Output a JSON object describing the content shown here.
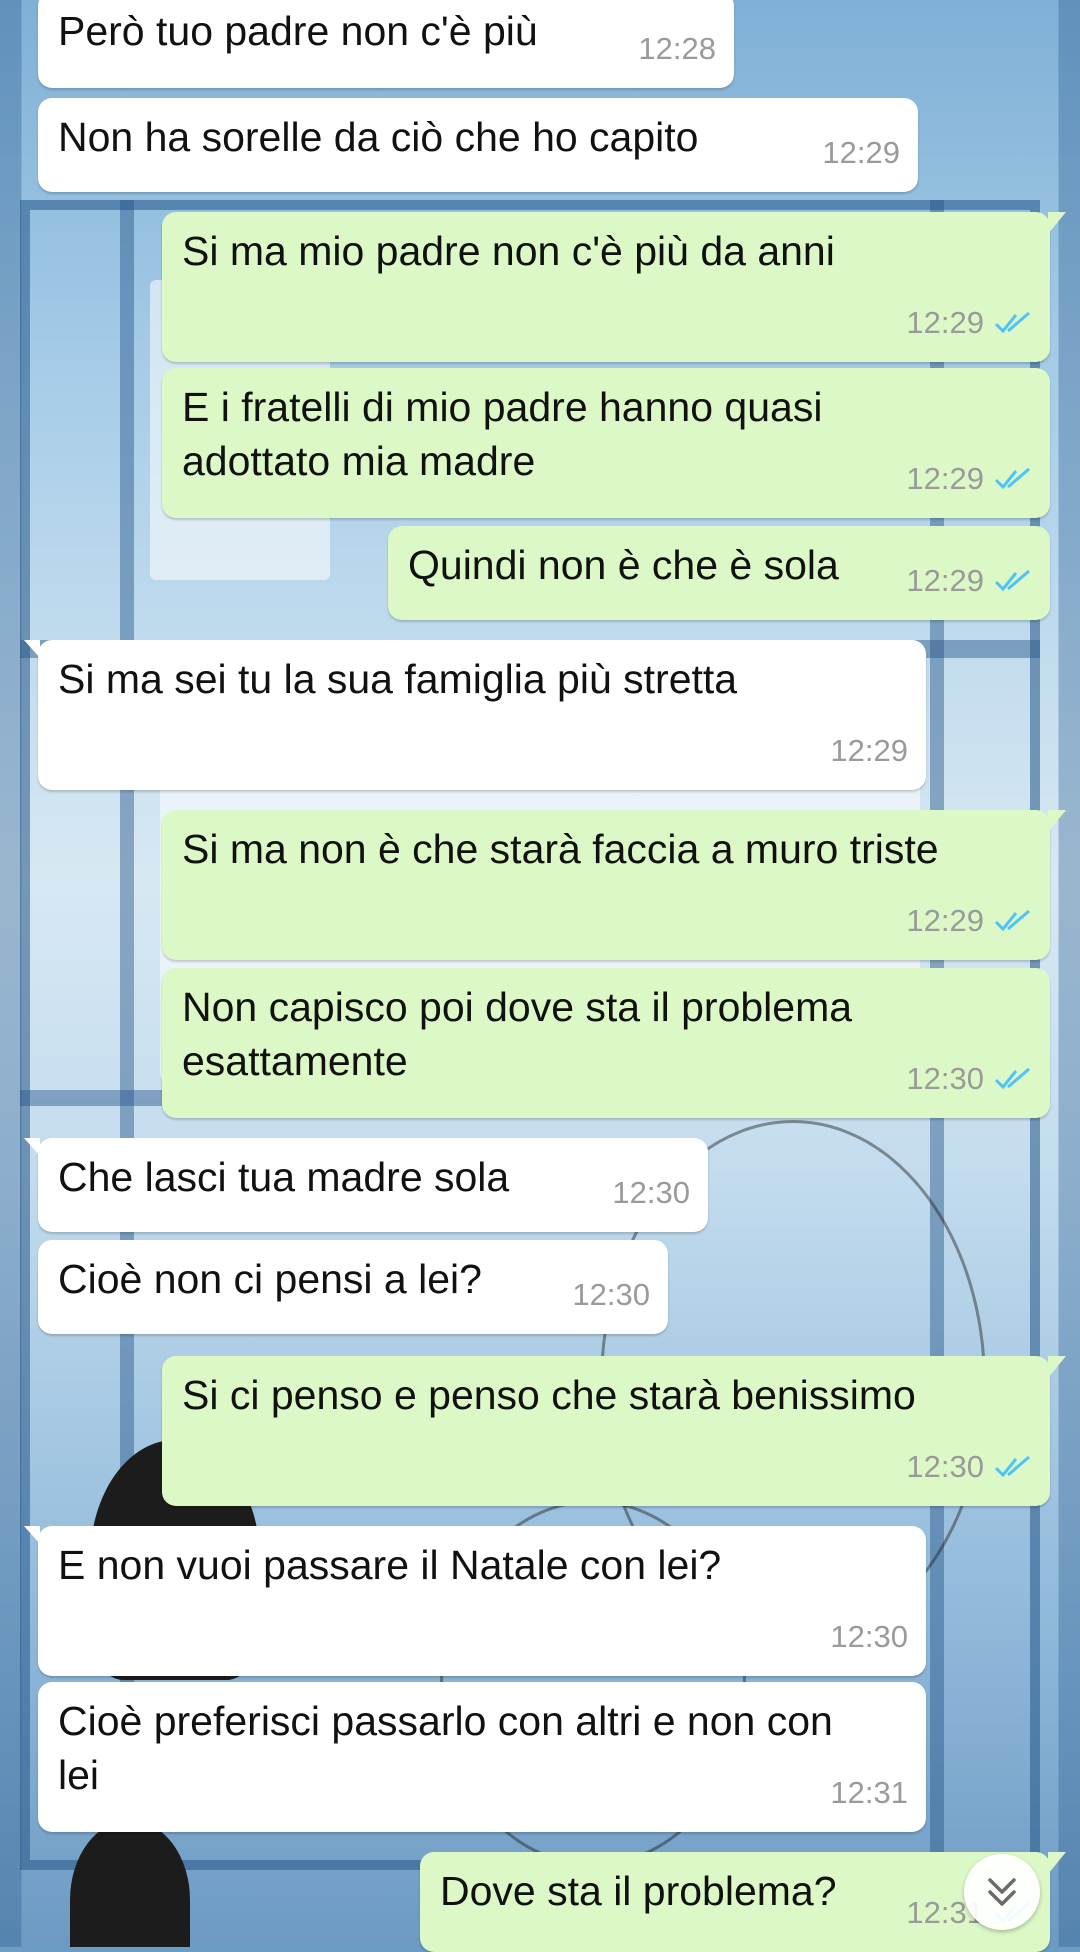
{
  "colors": {
    "incoming_bubble": "#ffffff",
    "outgoing_bubble": "#dcf8c6",
    "read_ticks": "#4fc3f7",
    "timestamp": "#9a9a9a"
  },
  "messages": [
    {
      "direction": "in",
      "text": "Però tuo padre non c'è più",
      "time": "12:28"
    },
    {
      "direction": "in",
      "text": "Non ha sorelle da ciò che ho capito",
      "time": "12:29"
    },
    {
      "direction": "out",
      "text": "Si ma mio padre non c'è più da anni",
      "time": "12:29",
      "status": "read"
    },
    {
      "direction": "out",
      "text": "E i fratelli di mio padre hanno quasi adottato mia madre",
      "time": "12:29",
      "status": "read"
    },
    {
      "direction": "out",
      "text": "Quindi non è che è sola",
      "time": "12:29",
      "status": "read"
    },
    {
      "direction": "in",
      "text": "Si ma sei tu la sua famiglia più stretta",
      "time": "12:29"
    },
    {
      "direction": "out",
      "text": "Si ma non è che starà faccia a muro triste",
      "time": "12:29",
      "status": "read"
    },
    {
      "direction": "out",
      "text": "Non capisco poi dove sta il problema esattamente",
      "time": "12:30",
      "status": "read"
    },
    {
      "direction": "in",
      "text": "Che lasci tua madre sola",
      "time": "12:30"
    },
    {
      "direction": "in",
      "text": "Cioè non ci pensi a lei?",
      "time": "12:30"
    },
    {
      "direction": "out",
      "text": "Si ci penso e penso che starà benissimo",
      "time": "12:30",
      "status": "read"
    },
    {
      "direction": "in",
      "text": "E non vuoi passare il Natale con lei?",
      "time": "12:30"
    },
    {
      "direction": "in",
      "text": "Cioè preferisci passarlo con altri e non con lei",
      "time": "12:31"
    },
    {
      "direction": "out",
      "text": "Dove sta il problema?",
      "time": "12:31",
      "status": "read"
    }
  ],
  "scroll_to_bottom": {
    "icon": "double-chevron-down-icon"
  }
}
